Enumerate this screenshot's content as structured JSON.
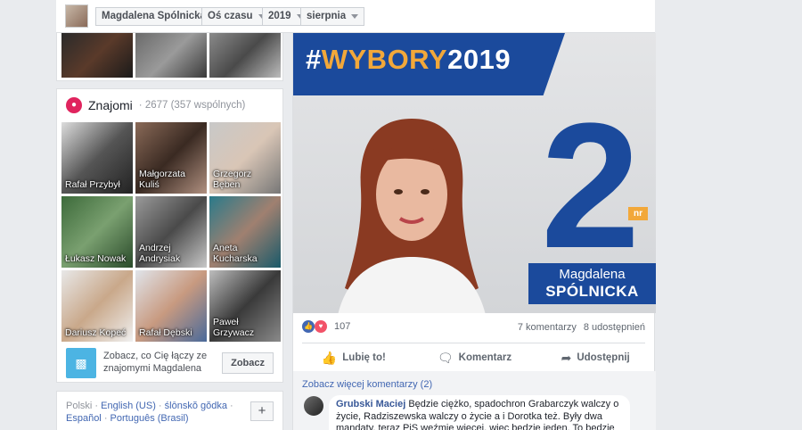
{
  "header": {
    "profile_name": "Magdalena Spólnicka",
    "timeline_label": "Oś czasu",
    "year": "2019",
    "month": "sierpnia"
  },
  "friends": {
    "title": "Znajomi",
    "count_text": "· 2677 (357 wspólnych)",
    "tiles": [
      {
        "name": "Rafał Przybył"
      },
      {
        "name": "Małgorzata Kuliś"
      },
      {
        "name": "Grzegorz Bęben"
      },
      {
        "name": "Łukasz Nowak"
      },
      {
        "name": "Andrzej Andrysiak"
      },
      {
        "name": "Aneta Kucharska"
      },
      {
        "name": "Dariusz Kopeć"
      },
      {
        "name": "Rafał Dębski"
      },
      {
        "name": "Paweł Grzywacz"
      }
    ],
    "connect_text": "Zobacz, co Cię łączy ze znajomymi Magdalena",
    "connect_button": "Zobacz"
  },
  "languages": {
    "current": "Polski",
    "links": [
      "English (US)",
      "ślōnskŏ gŏdka",
      "Español",
      "Português (Brasil)"
    ],
    "add_button": "+"
  },
  "post": {
    "banner_hash": "#",
    "banner_word": "WYBORY",
    "banner_year": "2019",
    "list_number": "2",
    "nr_label": "nr",
    "candidate_first": "Magdalena",
    "candidate_last": "SPÓLNICKA",
    "reaction_count": "107",
    "comments_count": "7 komentarzy",
    "shares_count": "8 udostępnień",
    "actions": {
      "like": "Lubię to!",
      "comment": "Komentarz",
      "share": "Udostępnij"
    },
    "more_comments": "Zobacz więcej komentarzy (2)",
    "comment": {
      "author": "Grubski Maciej",
      "text": " Będzie ciężko, spadochron Grabarczyk walczy o życie, Radziszewska walczy o życie a i Dorotka też. Były dwa mandaty, teraz PiS weźmie więcej, więc będzie jeden. To będzie"
    }
  },
  "colors": {
    "accent_blue": "#1b4a9c",
    "accent_orange": "#f2a83a",
    "link": "#4267b2"
  }
}
